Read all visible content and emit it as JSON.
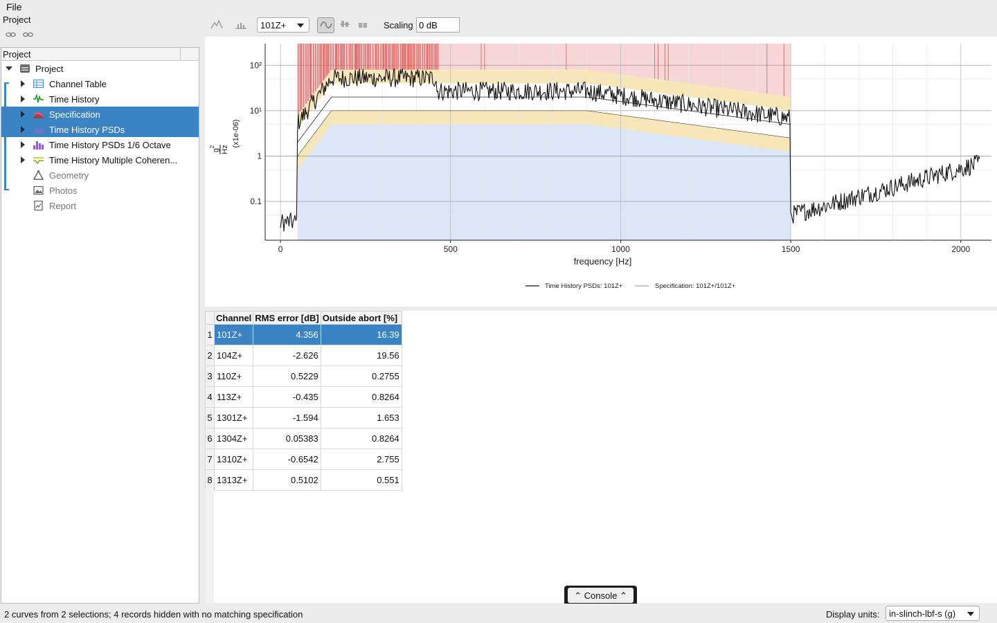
{
  "menu": {
    "file": "File"
  },
  "project_panel": {
    "title": "Project",
    "tree_header": "Project",
    "items": [
      {
        "label": "Project",
        "icon": "database-icon"
      },
      {
        "label": "Channel Table",
        "icon": "table-icon"
      },
      {
        "label": "Time History",
        "icon": "waveform-icon"
      },
      {
        "label": "Specification",
        "icon": "spec-area-icon"
      },
      {
        "label": "Time History PSDs",
        "icon": "psd-icon"
      },
      {
        "label": "Time History PSDs 1/6 Octave",
        "icon": "bar-chart-icon"
      },
      {
        "label": "Time History Multiple Coheren...",
        "icon": "coherence-icon"
      },
      {
        "label": "Geometry",
        "icon": "geometry-icon"
      },
      {
        "label": "Photos",
        "icon": "photo-icon"
      },
      {
        "label": "Report",
        "icon": "report-icon"
      }
    ]
  },
  "toolbar": {
    "channel_select": "101Z+",
    "scaling_label": "Scaling",
    "scaling_value": "0 dB"
  },
  "chart_data": {
    "type": "line",
    "xlabel": "frequency [Hz]",
    "ylabel_num": "g",
    "ylabel_den": "Hz",
    "ylabel_exp": "2",
    "ylabel_scale": "(x1e-06)",
    "yscale": "log",
    "xlim": [
      -45,
      2090
    ],
    "ylim": [
      0.014,
      300
    ],
    "x_ticks": [
      "0",
      "500",
      "1000",
      "1500",
      "2000"
    ],
    "y_ticks": [
      "0.1",
      "1",
      "10¹",
      "10²"
    ],
    "grid": true,
    "legend_position": "bottom",
    "series": [
      {
        "name": "Time History PSDs: 101Z+"
      },
      {
        "name": "Specification: 101Z+/101Z+",
        "x": [
          50,
          150,
          900,
          1500
        ],
        "values": [
          2,
          20,
          20,
          5
        ]
      }
    ],
    "abort_upper": {
      "x": [
        50,
        150,
        900,
        1500
      ],
      "values": [
        8,
        80,
        80,
        20
      ]
    },
    "alarm_upper": {
      "x": [
        50,
        150,
        900,
        1500
      ],
      "values": [
        4,
        40,
        40,
        10
      ]
    },
    "alarm_lower": {
      "x": [
        50,
        150,
        900,
        1500
      ],
      "values": [
        1,
        10,
        10,
        2.5
      ]
    },
    "abort_lower": {
      "x": [
        50,
        150,
        900,
        1500
      ],
      "values": [
        0.5,
        5,
        5,
        1.25
      ]
    }
  },
  "table": {
    "columns": [
      "Channel",
      "RMS error [dB]",
      "Outside abort [%]"
    ],
    "rows": [
      [
        "101Z+",
        "4.356",
        "16.39"
      ],
      [
        "104Z+",
        "-2.626",
        "19.56"
      ],
      [
        "110Z+",
        "0.5229",
        "0.2755"
      ],
      [
        "113Z+",
        "-0.435",
        "0.8264"
      ],
      [
        "1301Z+",
        "-1.594",
        "1.653"
      ],
      [
        "1304Z+",
        "0.05383",
        "0.8264"
      ],
      [
        "1310Z+",
        "-0.6542",
        "2.755"
      ],
      [
        "1313Z+",
        "0.5102",
        "0.551"
      ]
    ]
  },
  "console": {
    "label": "Console"
  },
  "status": {
    "message": "2 curves from 2 selections; 4 records hidden with no matching specification",
    "units_label": "Display units:",
    "units_value": "in-slinch-lbf-s (g)"
  },
  "colors": {
    "selection": "#3a84c6",
    "abort": "#e07b7b",
    "alarm": "#f7e6b8",
    "band": "#dbe6f6"
  }
}
